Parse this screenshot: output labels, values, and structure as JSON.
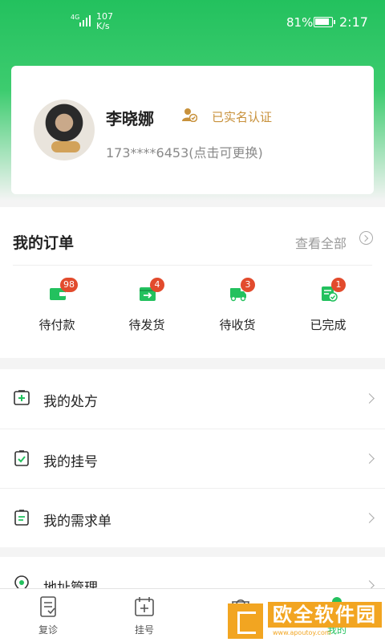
{
  "status_bar": {
    "network": "4G",
    "speed_value": "107",
    "speed_unit": "K/s",
    "battery": "81%",
    "time": "2:17"
  },
  "profile": {
    "name": "李晓娜",
    "verified_text": "已实名认证",
    "phone": "173****6453(点击可更换)"
  },
  "orders": {
    "title": "我的订单",
    "view_all": "查看全部",
    "items": [
      {
        "label": "待付款",
        "badge": "98",
        "icon": "wallet-icon"
      },
      {
        "label": "待发货",
        "badge": "4",
        "icon": "outbox-icon"
      },
      {
        "label": "待收货",
        "badge": "3",
        "icon": "truck-icon"
      },
      {
        "label": "已完成",
        "badge": "1",
        "icon": "completed-doc-icon"
      }
    ]
  },
  "menu": {
    "items": [
      {
        "label": "我的处方",
        "icon": "prescription-icon"
      },
      {
        "label": "我的挂号",
        "icon": "registration-icon"
      },
      {
        "label": "我的需求单",
        "icon": "demand-list-icon"
      }
    ],
    "address": {
      "label": "地址管理",
      "icon": "location-icon"
    }
  },
  "tabs": [
    {
      "label": "复诊",
      "icon": "revisit-icon"
    },
    {
      "label": "挂号",
      "icon": "register-icon"
    },
    {
      "label": "",
      "icon": "shop-icon"
    },
    {
      "label": "我的",
      "icon": "profile-icon"
    }
  ],
  "colors": {
    "brand_green": "#23c15e",
    "badge_red": "#e24b2d",
    "verify_gold": "#c8913b"
  }
}
